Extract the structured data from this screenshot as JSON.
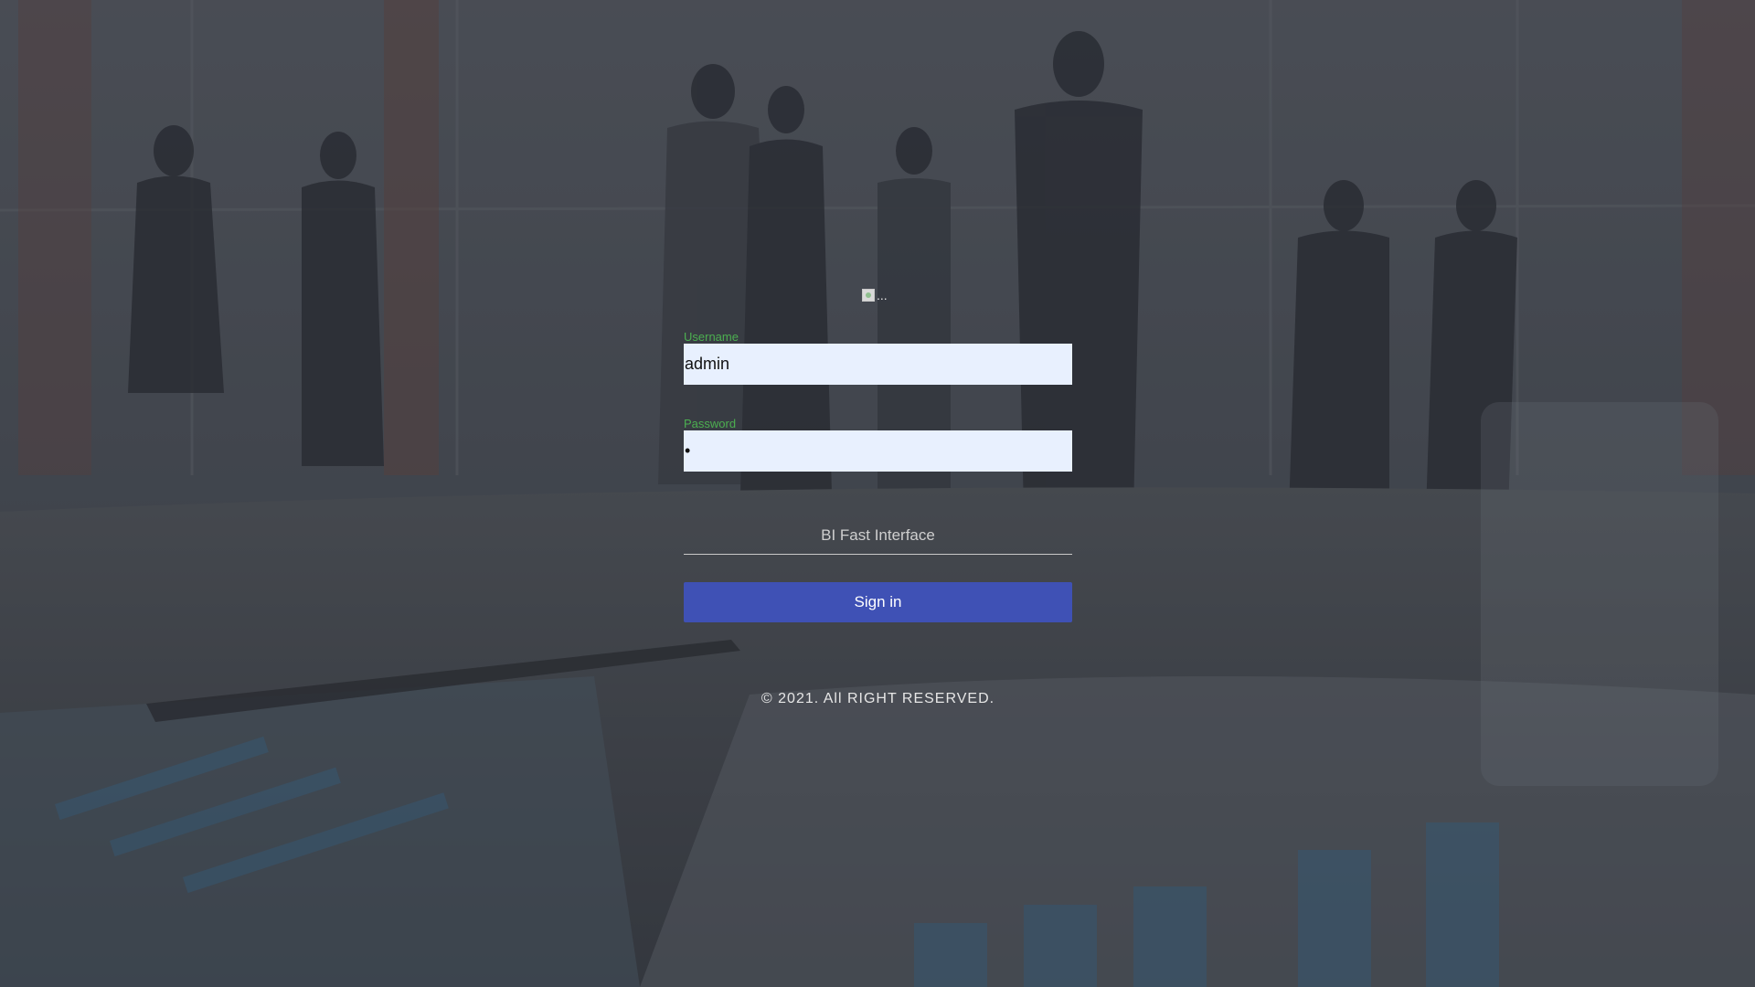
{
  "logo": {
    "alt_text": "..."
  },
  "form": {
    "username_label": "Username",
    "username_value": "admin",
    "password_label": "Password",
    "password_value": "•",
    "interface_select_value": "BI Fast Interface",
    "signin_label": "Sign in"
  },
  "footer": {
    "copyright": "© 2021. All RIGHT RESERVED."
  },
  "colors": {
    "accent_label": "#4caf50",
    "button_primary": "#3f51b5",
    "input_autofill_bg": "#e8f0fe"
  }
}
